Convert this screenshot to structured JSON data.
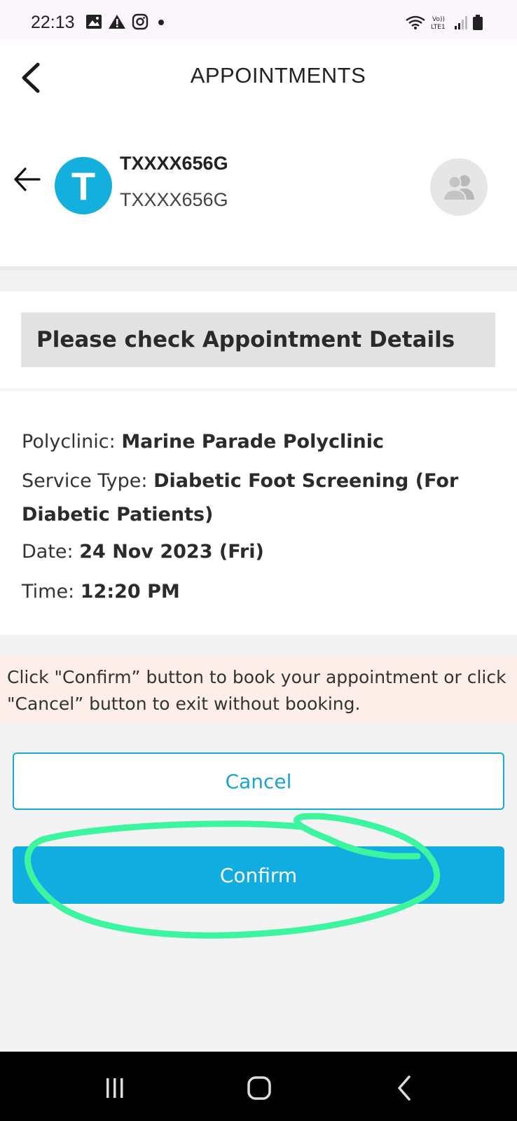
{
  "status_bar": {
    "time": "22:13",
    "left_icons": [
      "gallery-icon",
      "warning-icon",
      "instagram-icon",
      "dot-icon"
    ],
    "right_icons": [
      "wifi-icon",
      "volte-icon",
      "signal-icon",
      "battery-icon"
    ],
    "volte_label": "Vo))\nLTE1"
  },
  "header": {
    "title": "APPOINTMENTS"
  },
  "profile": {
    "avatar_letter": "T",
    "name": "TXXXX656G",
    "id": "TXXXX656G",
    "avatar_color": "#13b0de"
  },
  "notice": {
    "title": "Please check Appointment Details"
  },
  "details": {
    "polyclinic_label": "Polyclinic: ",
    "polyclinic_value": "Marine Parade Polyclinic",
    "service_label": "Service Type: ",
    "service_value": "Diabetic Foot Screening (For Diabetic Patients)",
    "date_label": "Date: ",
    "date_value": "24 Nov 2023 (Fri)",
    "time_label": "Time: ",
    "time_value": "12:20 PM"
  },
  "info_banner": {
    "text": "Click \"Confirm” button to book your appointment or click \"Cancel” button to exit without booking."
  },
  "buttons": {
    "cancel_label": "Cancel",
    "confirm_label": "Confirm"
  },
  "colors": {
    "accent": "#12ade0",
    "annotation": "#3cf59e",
    "banner": "#fdeeea"
  }
}
